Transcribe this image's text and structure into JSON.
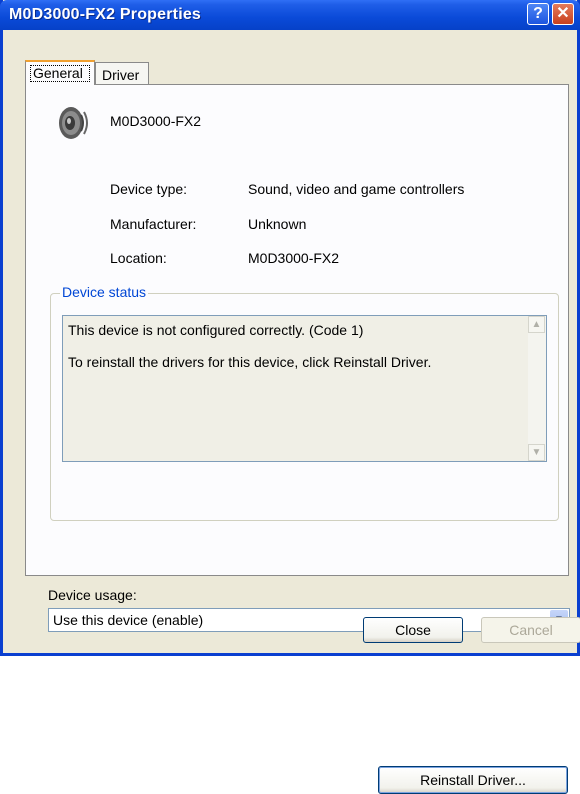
{
  "window": {
    "title": "M0D3000-FX2 Properties",
    "help_glyph": "?",
    "close_glyph": "✕"
  },
  "tabs": [
    {
      "label": "General"
    },
    {
      "label": "Driver"
    }
  ],
  "device": {
    "icon": "speaker-icon",
    "name": "M0D3000-FX2",
    "fields": [
      {
        "label": "Device type:",
        "value": "Sound, video and game controllers"
      },
      {
        "label": "Manufacturer:",
        "value": "Unknown"
      },
      {
        "label": "Location:",
        "value": "M0D3000-FX2"
      }
    ]
  },
  "status": {
    "legend": "Device status",
    "lines": [
      "This device is not configured correctly. (Code 1)",
      "To reinstall the drivers for this device, click Reinstall Driver."
    ],
    "reinstall_label": "Reinstall Driver..."
  },
  "usage": {
    "label": "Device usage:",
    "selected": "Use this device (enable)"
  },
  "buttons": {
    "close": "Close",
    "cancel": "Cancel"
  },
  "colors": {
    "titlebar": "#0a4ad8",
    "frame": "#ece9d8",
    "legend": "#0046d5",
    "tab_highlight": "#f0a030"
  }
}
